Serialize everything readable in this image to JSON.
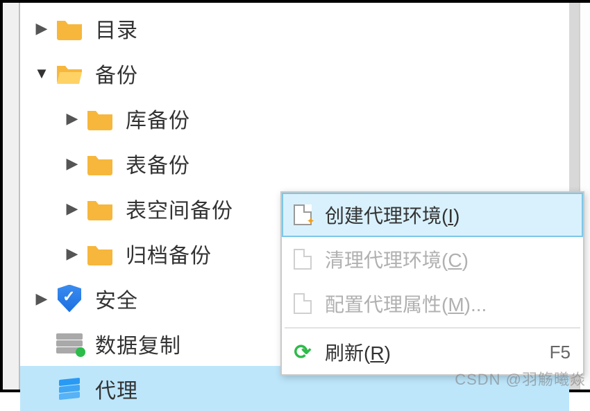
{
  "tree": {
    "directory": "目录",
    "backup": "备份",
    "lib_backup": "库备份",
    "table_backup": "表备份",
    "tablespace_backup": "表空间备份",
    "archive_backup": "归档备份",
    "security": "安全",
    "replication": "数据复制",
    "agent": "代理"
  },
  "menu": {
    "create_agent_env": "创建代理环境(I)",
    "clean_agent_env": "清理代理环境(C)",
    "config_agent_props": "配置代理属性(M)...",
    "refresh": "刷新(R)",
    "refresh_shortcut": "F5"
  },
  "watermark": "CSDN @羽觞曦焱"
}
